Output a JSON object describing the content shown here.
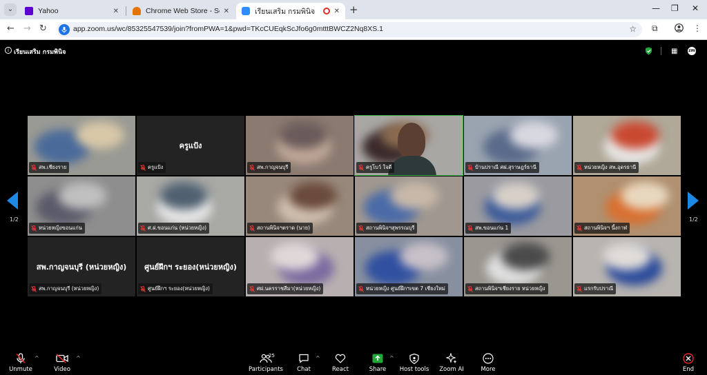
{
  "browser": {
    "tabs": [
      {
        "title": "Yahoo",
        "favicon_color": "#6001d2"
      },
      {
        "title": "Chrome Web Store - Search Re",
        "favicon_color": "#e37400"
      },
      {
        "title": "เรียนเสริม กรมพินิจ",
        "favicon_color": "#2d8cff"
      }
    ],
    "url": "app.zoom.us/wc/85325547539/join?fromPWA=1&pwd=TKcCUEqkScJfo6g0mtttBWCZ2Nq8XS.1"
  },
  "meeting": {
    "title": "เรียนเสริม กรมพินิจ"
  },
  "gallery": {
    "page_left": "1/2",
    "page_right": "1/2",
    "tiles": [
      {
        "name": "สพ.เชียงราย",
        "center": "",
        "bg": "#9a9a94",
        "c1": "#4a6a9a",
        "c2": "#d8c8a8"
      },
      {
        "name": "ครูแป้ง",
        "center": "ครูแป้ง",
        "bg": "#232323",
        "c1": "",
        "c2": ""
      },
      {
        "name": "สพ.กาญจนบุรี",
        "center": "",
        "bg": "#8a7a70",
        "c1": "#c0a898",
        "c2": "#6a5a5a"
      },
      {
        "name": "ครูโบว์ ใจดี",
        "center": "",
        "bg": "#a9a7a4",
        "c1": "#3a2a2a",
        "c2": "#8a6a50"
      },
      {
        "name": "บ้านปราณี ศฝ.สุราษฎร์ธานี",
        "center": "",
        "bg": "#9aa4b0",
        "c1": "#5a6a8a",
        "c2": "#d8d8e0"
      },
      {
        "name": "หน่วยหญิง สพ.อุดรธานี",
        "center": "",
        "bg": "#b0a898",
        "c1": "#e8e8e8",
        "c2": "#c84830"
      },
      {
        "name": "หน่วยหญิงขอนแก่น",
        "center": "",
        "bg": "#8e8e8e",
        "c1": "#5a5a6a",
        "c2": "#c0c0c0"
      },
      {
        "name": "ศ.ฝ.ขอนแก่น (หน่วยหญิง)",
        "center": "",
        "bg": "#a8a8a4",
        "c1": "#e8e8e8",
        "c2": "#506070"
      },
      {
        "name": "สถานพินิจฯตราด (นาย)",
        "center": "",
        "bg": "#98887c",
        "c1": "#d0c0b0",
        "c2": "#6a4a3a"
      },
      {
        "name": "สถานพินิจฯสุพรรณบุรี",
        "center": "",
        "bg": "#a09890",
        "c1": "#4a6aa8",
        "c2": "#c8b8a8"
      },
      {
        "name": "สพ.ขอนแก่น 1",
        "center": "",
        "bg": "#9a9aa0",
        "c1": "#3a5a9a",
        "c2": "#d8d0c8"
      },
      {
        "name": "สถานพินิจฯ นี้งกาฬ",
        "center": "",
        "bg": "#b09070",
        "c1": "#d87030",
        "c2": "#e8d8c0"
      },
      {
        "name": "สพ.กาญจนบุรี (หน่วยหญิง)",
        "center": "สพ.กาญจนบุรี (หน่วยหญิง)",
        "bg": "#232323",
        "c1": "",
        "c2": ""
      },
      {
        "name": "ศูนย์ฝึกฯ ระยอง(หน่วยหญิง)",
        "center": "ศูนย์ฝึกฯ ระยอง(หน่วยหญิง)",
        "bg": "#232323",
        "c1": "",
        "c2": ""
      },
      {
        "name": "ศฝ.นครราชสีมา(หน่วยหญิง)",
        "center": "",
        "bg": "#b8b0b0",
        "c1": "#7a6aa0",
        "c2": "#e0d8d8"
      },
      {
        "name": "หน่วยหญิง ศูนย์ฝึกฯเขต 7 เชียงใหม่",
        "center": "",
        "bg": "#8890a0",
        "c1": "#3050a0",
        "c2": "#c8c0c8"
      },
      {
        "name": "สถานพินิจฯเชียงราย หน่วยหญิง",
        "center": "",
        "bg": "#9a9690",
        "c1": "#e0e0e0",
        "c2": "#4a4a4a"
      },
      {
        "name": "แรกรับปราณี",
        "center": "",
        "bg": "#b8b4b0",
        "c1": "#2a4a9a",
        "c2": "#e0dcd8"
      }
    ]
  },
  "toolbar": {
    "unmute": "Unmute",
    "video": "Video",
    "participants": "Participants",
    "participants_count": "25",
    "chat": "Chat",
    "react": "React",
    "share": "Share",
    "host_tools": "Host tools",
    "zoom_ai": "Zoom AI",
    "more": "More",
    "end": "End"
  }
}
